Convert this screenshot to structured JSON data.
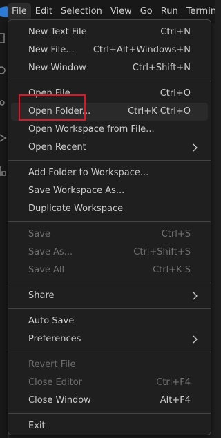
{
  "menubar": {
    "items": [
      {
        "label": "File"
      },
      {
        "label": "Edit"
      },
      {
        "label": "Selection"
      },
      {
        "label": "View"
      },
      {
        "label": "Go"
      },
      {
        "label": "Run"
      },
      {
        "label": "Terminal"
      }
    ]
  },
  "file_menu": {
    "items": [
      {
        "label": "New Text File",
        "shortcut": "Ctrl+N"
      },
      {
        "label": "New File...",
        "shortcut": "Ctrl+Alt+Windows+N"
      },
      {
        "label": "New Window",
        "shortcut": "Ctrl+Shift+N"
      },
      {
        "label": "Open File...",
        "shortcut": "Ctrl+O"
      },
      {
        "label": "Open Folder...",
        "shortcut": "Ctrl+K Ctrl+O"
      },
      {
        "label": "Open Workspace from File...",
        "shortcut": ""
      },
      {
        "label": "Open Recent",
        "shortcut": ""
      },
      {
        "label": "Add Folder to Workspace...",
        "shortcut": ""
      },
      {
        "label": "Save Workspace As...",
        "shortcut": ""
      },
      {
        "label": "Duplicate Workspace",
        "shortcut": ""
      },
      {
        "label": "Save",
        "shortcut": "Ctrl+S"
      },
      {
        "label": "Save As...",
        "shortcut": "Ctrl+Shift+S"
      },
      {
        "label": "Save All",
        "shortcut": "Ctrl+K S"
      },
      {
        "label": "Share",
        "shortcut": ""
      },
      {
        "label": "Auto Save",
        "shortcut": ""
      },
      {
        "label": "Preferences",
        "shortcut": ""
      },
      {
        "label": "Revert File",
        "shortcut": ""
      },
      {
        "label": "Close Editor",
        "shortcut": "Ctrl+F4"
      },
      {
        "label": "Close Window",
        "shortcut": "Alt+F4"
      },
      {
        "label": "Exit",
        "shortcut": ""
      }
    ]
  },
  "icons": [
    "app-logo-icon",
    "explorer-icon",
    "search-icon",
    "source-control-icon",
    "run-debug-icon",
    "extensions-icon",
    "chevron-right-icon"
  ],
  "colors": {
    "highlight_border": "#e81123",
    "menu_background": "#1f1f1f",
    "disabled_text": "#6f6f6f",
    "text": "#cccccc"
  }
}
